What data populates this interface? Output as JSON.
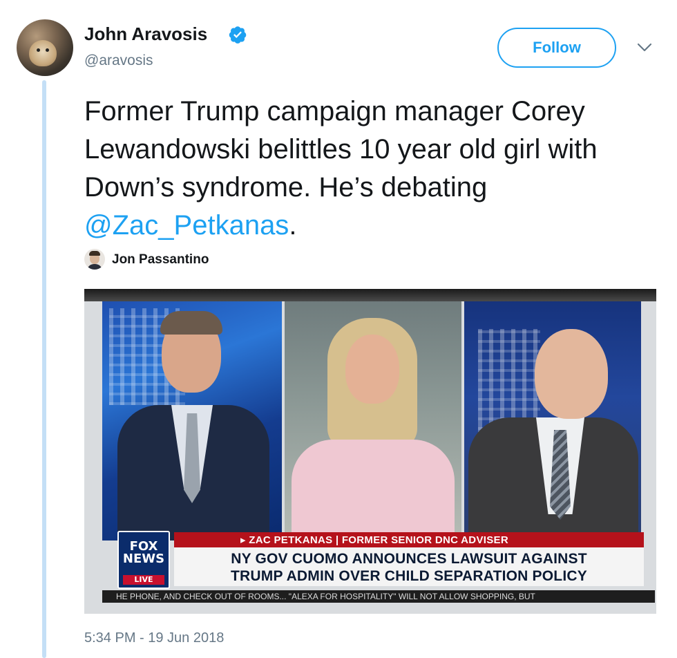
{
  "author": {
    "name": "John Aravosis",
    "handle": "@aravosis",
    "verified": true
  },
  "actions": {
    "follow_label": "Follow",
    "menu_icon": "chevron-down-icon"
  },
  "tweet": {
    "text_before": "Former Trump campaign manager Corey Lewandowski belittles 10 year old girl with Down’s syndrome. He’s debating ",
    "mention": "@Zac_Petkanas",
    "text_after": ".",
    "tagged_user": "Jon Passantino",
    "timestamp": "5:34 PM - 19 Jun 2018"
  },
  "video": {
    "network_logo": "FOX NEWS",
    "live_label": "LIVE",
    "banner_top": "▸ ZAC PETKANAS | FORMER SENIOR DNC ADVISER",
    "headline_line1": "NY GOV CUOMO ANNOUNCES LAWSUIT AGAINST",
    "headline_line2": "TRUMP ADMIN OVER CHILD SEPARATION POLICY",
    "ticker": "HE PHONE, AND CHECK OUT OF ROOMS...  \"ALEXA FOR HOSPITALITY\" WILL NOT ALLOW SHOPPING, BUT"
  },
  "colors": {
    "accent": "#1da1f2",
    "thread_line": "#c4dff6",
    "secondary_text": "#657786",
    "fox_red": "#b5121b",
    "fox_blue": "#0b2c6b"
  }
}
